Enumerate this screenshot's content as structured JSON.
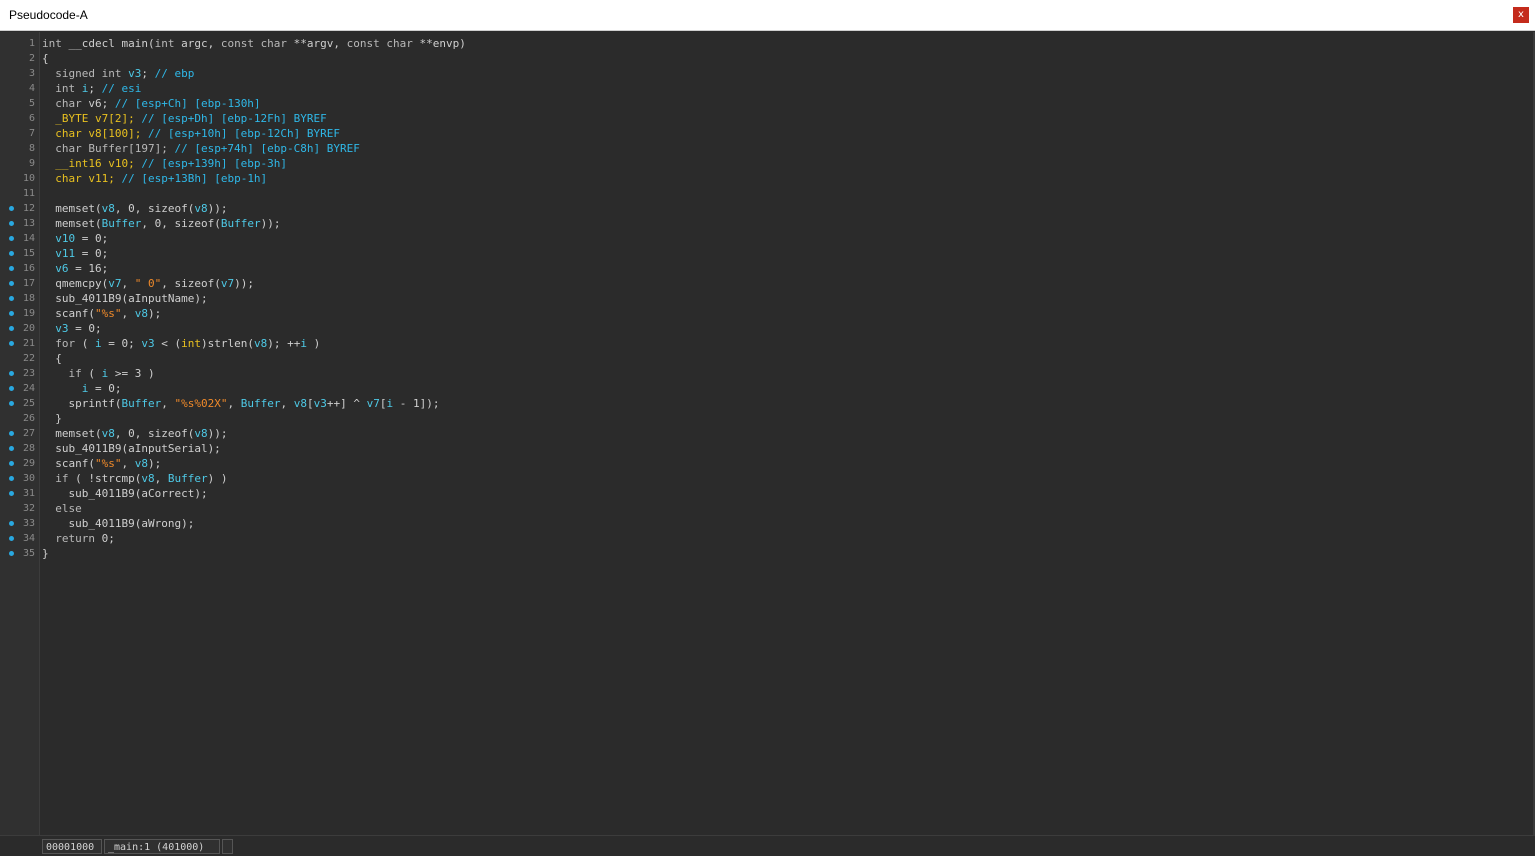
{
  "window": {
    "title": "Pseudocode-A",
    "close_label": "x"
  },
  "code_lines": [
    {
      "n": "1",
      "bp": false,
      "t": [
        [
          "kw",
          "int"
        ],
        [
          "id",
          " __cdecl main("
        ],
        [
          "kw",
          "int"
        ],
        [
          "id",
          " argc, "
        ],
        [
          "kw",
          "const char"
        ],
        [
          "id",
          " **argv, "
        ],
        [
          "kw",
          "const char"
        ],
        [
          "id",
          " **envp)"
        ]
      ]
    },
    {
      "n": "2",
      "bp": false,
      "t": [
        [
          "id",
          "{"
        ]
      ]
    },
    {
      "n": "3",
      "bp": false,
      "t": [
        [
          "kw",
          "  signed int "
        ],
        [
          "var",
          "v3"
        ],
        [
          "id",
          "; "
        ],
        [
          "cm",
          "// ebp"
        ]
      ]
    },
    {
      "n": "4",
      "bp": false,
      "t": [
        [
          "kw",
          "  int "
        ],
        [
          "var",
          "i"
        ],
        [
          "id",
          "; "
        ],
        [
          "cm",
          "// esi"
        ]
      ]
    },
    {
      "n": "5",
      "bp": false,
      "t": [
        [
          "kw",
          "  char "
        ],
        [
          "id",
          "v6; "
        ],
        [
          "cm",
          "// [esp+Ch] [ebp-130h]"
        ]
      ]
    },
    {
      "n": "6",
      "bp": false,
      "t": [
        [
          "yl",
          "  _BYTE v7[2]; "
        ],
        [
          "cm",
          "// [esp+Dh] [ebp-12Fh] BYREF"
        ]
      ]
    },
    {
      "n": "7",
      "bp": false,
      "t": [
        [
          "yl",
          "  char v8[100]; "
        ],
        [
          "cm",
          "// [esp+10h] [ebp-12Ch] BYREF"
        ]
      ]
    },
    {
      "n": "8",
      "bp": false,
      "t": [
        [
          "kw",
          "  char Buffer[197]; "
        ],
        [
          "cm",
          "// [esp+74h] [ebp-C8h] BYREF"
        ]
      ]
    },
    {
      "n": "9",
      "bp": false,
      "t": [
        [
          "yl",
          "  __int16 v10; "
        ],
        [
          "cm",
          "// [esp+139h] [ebp-3h]"
        ]
      ]
    },
    {
      "n": "10",
      "bp": false,
      "t": [
        [
          "yl",
          "  char v11; "
        ],
        [
          "cm",
          "// [esp+13Bh] [ebp-1h]"
        ]
      ]
    },
    {
      "n": "11",
      "bp": false,
      "t": [
        [
          "id",
          ""
        ]
      ]
    },
    {
      "n": "12",
      "bp": true,
      "t": [
        [
          "id",
          "  memset("
        ],
        [
          "var",
          "v8"
        ],
        [
          "id",
          ", 0, sizeof("
        ],
        [
          "var",
          "v8"
        ],
        [
          "id",
          "));"
        ]
      ]
    },
    {
      "n": "13",
      "bp": true,
      "t": [
        [
          "id",
          "  memset("
        ],
        [
          "var",
          "Buffer"
        ],
        [
          "id",
          ", 0, sizeof("
        ],
        [
          "var",
          "Buffer"
        ],
        [
          "id",
          "));"
        ]
      ]
    },
    {
      "n": "14",
      "bp": true,
      "t": [
        [
          "var",
          "  v10"
        ],
        [
          "id",
          " = 0;"
        ]
      ]
    },
    {
      "n": "15",
      "bp": true,
      "t": [
        [
          "var",
          "  v11"
        ],
        [
          "id",
          " = 0;"
        ]
      ]
    },
    {
      "n": "16",
      "bp": true,
      "t": [
        [
          "var",
          "  v6"
        ],
        [
          "id",
          " = 16;"
        ]
      ]
    },
    {
      "n": "17",
      "bp": true,
      "t": [
        [
          "id",
          "  qmemcpy("
        ],
        [
          "var",
          "v7"
        ],
        [
          "id",
          ", "
        ],
        [
          "str",
          "\" 0\""
        ],
        [
          "id",
          ", sizeof("
        ],
        [
          "var",
          "v7"
        ],
        [
          "id",
          "));"
        ]
      ]
    },
    {
      "n": "18",
      "bp": true,
      "t": [
        [
          "id",
          "  sub_4011B9(aInputName);"
        ]
      ]
    },
    {
      "n": "19",
      "bp": true,
      "t": [
        [
          "id",
          "  scanf("
        ],
        [
          "str",
          "\"%s\""
        ],
        [
          "id",
          ", "
        ],
        [
          "var",
          "v8"
        ],
        [
          "id",
          ");"
        ]
      ]
    },
    {
      "n": "20",
      "bp": true,
      "t": [
        [
          "var",
          "  v3"
        ],
        [
          "id",
          " = 0;"
        ]
      ]
    },
    {
      "n": "21",
      "bp": true,
      "t": [
        [
          "kw",
          "  for"
        ],
        [
          "id",
          " ( "
        ],
        [
          "var",
          "i"
        ],
        [
          "id",
          " = 0; "
        ],
        [
          "var",
          "v3"
        ],
        [
          "id",
          " < ("
        ],
        [
          "yl",
          "int"
        ],
        [
          "id",
          ")strlen("
        ],
        [
          "var",
          "v8"
        ],
        [
          "id",
          "); ++"
        ],
        [
          "var",
          "i"
        ],
        [
          "id",
          " )"
        ]
      ]
    },
    {
      "n": "22",
      "bp": false,
      "t": [
        [
          "id",
          "  {"
        ]
      ]
    },
    {
      "n": "23",
      "bp": true,
      "t": [
        [
          "kw",
          "    if"
        ],
        [
          "id",
          " ( "
        ],
        [
          "var",
          "i"
        ],
        [
          "id",
          " >= 3 )"
        ]
      ]
    },
    {
      "n": "24",
      "bp": true,
      "t": [
        [
          "var",
          "      i"
        ],
        [
          "id",
          " = 0;"
        ]
      ]
    },
    {
      "n": "25",
      "bp": true,
      "t": [
        [
          "id",
          "    sprintf("
        ],
        [
          "var",
          "Buffer"
        ],
        [
          "id",
          ", "
        ],
        [
          "str",
          "\"%s%02X\""
        ],
        [
          "id",
          ", "
        ],
        [
          "var",
          "Buffer"
        ],
        [
          "id",
          ", "
        ],
        [
          "var",
          "v8"
        ],
        [
          "id",
          "["
        ],
        [
          "var",
          "v3"
        ],
        [
          "id",
          "++] ^ "
        ],
        [
          "var",
          "v7"
        ],
        [
          "id",
          "["
        ],
        [
          "var",
          "i"
        ],
        [
          "id",
          " - 1]);"
        ]
      ]
    },
    {
      "n": "26",
      "bp": false,
      "t": [
        [
          "id",
          "  }"
        ]
      ]
    },
    {
      "n": "27",
      "bp": true,
      "t": [
        [
          "id",
          "  memset("
        ],
        [
          "var",
          "v8"
        ],
        [
          "id",
          ", 0, sizeof("
        ],
        [
          "var",
          "v8"
        ],
        [
          "id",
          "));"
        ]
      ]
    },
    {
      "n": "28",
      "bp": true,
      "t": [
        [
          "id",
          "  sub_4011B9(aInputSerial);"
        ]
      ]
    },
    {
      "n": "29",
      "bp": true,
      "t": [
        [
          "id",
          "  scanf("
        ],
        [
          "str",
          "\"%s\""
        ],
        [
          "id",
          ", "
        ],
        [
          "var",
          "v8"
        ],
        [
          "id",
          ");"
        ]
      ]
    },
    {
      "n": "30",
      "bp": true,
      "t": [
        [
          "kw",
          "  if"
        ],
        [
          "id",
          " ( !strcmp("
        ],
        [
          "var",
          "v8"
        ],
        [
          "id",
          ", "
        ],
        [
          "var",
          "Buffer"
        ],
        [
          "id",
          ") )"
        ]
      ]
    },
    {
      "n": "31",
      "bp": true,
      "t": [
        [
          "id",
          "    sub_4011B9(aCorrect);"
        ]
      ]
    },
    {
      "n": "32",
      "bp": false,
      "t": [
        [
          "kw",
          "  else"
        ]
      ]
    },
    {
      "n": "33",
      "bp": true,
      "t": [
        [
          "id",
          "    sub_4011B9(aWrong);"
        ]
      ]
    },
    {
      "n": "34",
      "bp": true,
      "t": [
        [
          "kw",
          "  return"
        ],
        [
          "id",
          " 0;"
        ]
      ]
    },
    {
      "n": "35",
      "bp": true,
      "t": [
        [
          "id",
          "}"
        ]
      ]
    }
  ],
  "status": {
    "address": "00001000",
    "location": "_main:1 (401000)"
  },
  "colors": {
    "accent": "#29a8e0",
    "keyword": "#b8b8b8",
    "variable": "#4ec9e6",
    "comment": "#2fb8e8",
    "type": "#e8c020",
    "string": "#f08a2a"
  }
}
